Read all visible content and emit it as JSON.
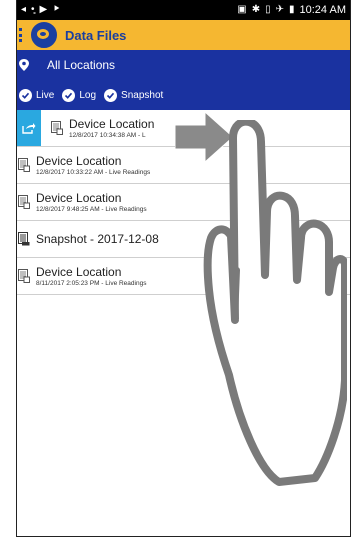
{
  "status_bar": {
    "time": "10:24 AM"
  },
  "header": {
    "title": "Data Files"
  },
  "location": {
    "label": "All Locations"
  },
  "filters": [
    {
      "label": "Live"
    },
    {
      "label": "Log"
    },
    {
      "label": "Snapshot"
    }
  ],
  "files": [
    {
      "title": "Device Location",
      "subtitle": "12/8/2017 10:34:38 AM - L",
      "selected": true
    },
    {
      "title": "Device Location",
      "subtitle": "12/8/2017 10:33:22 AM - Live Readings"
    },
    {
      "title": "Device Location",
      "subtitle": "12/8/2017 9:48:25 AM - Live Readings"
    },
    {
      "title": "Snapshot - 2017-12-08",
      "subtitle": ""
    },
    {
      "title": "Device Location",
      "subtitle": "8/11/2017 2:05:23 PM - Live Readings"
    }
  ],
  "colors": {
    "header": "#f5b731",
    "bar": "#1a32a0",
    "accent": "#2aa8e0"
  }
}
